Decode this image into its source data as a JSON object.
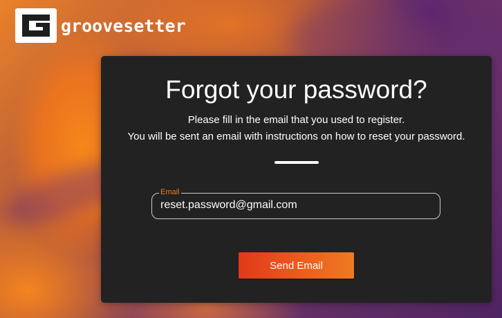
{
  "brand": {
    "name": "groovesetter",
    "logo_icon": "g-logo-icon"
  },
  "form": {
    "title": "Forgot your password?",
    "instructions_line1": "Please fill in the email that you used to register.",
    "instructions_line2": "You will be sent an email with instructions on how to reset your password.",
    "email": {
      "label": "Email",
      "value": "reset.password@gmail.com"
    },
    "submit_label": "Send Email"
  },
  "colors": {
    "accent": "#f07a20",
    "button_start": "#e0391a",
    "card_background": "#222222"
  }
}
